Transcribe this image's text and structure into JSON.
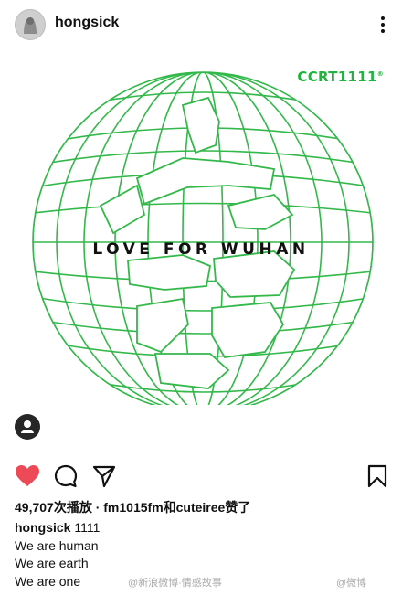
{
  "header": {
    "username": "hongsick",
    "avatar_icon": "profile-avatar",
    "more_icon": "more-vertical-icon"
  },
  "image": {
    "brand": "CCRT1111",
    "brand_mark": "®",
    "headline": "LOVE FOR WUHAN",
    "globe_color": "#33b84a",
    "tag_icon": "user-tag-icon"
  },
  "actions": {
    "like_icon": "heart-filled-icon",
    "comment_icon": "comment-icon",
    "share_icon": "send-icon",
    "save_icon": "bookmark-icon",
    "like_color": "#ed4956"
  },
  "likes": {
    "count": "49,707次播放",
    "rest": "· fm1015fm和cuteiree赞了"
  },
  "caption": {
    "username": "hongsick",
    "text": "1111",
    "lines": [
      "We are human",
      "We are earth",
      "We are one"
    ]
  },
  "watermarks": {
    "left": "@新浪微博·情感故事",
    "right": "@微博"
  }
}
